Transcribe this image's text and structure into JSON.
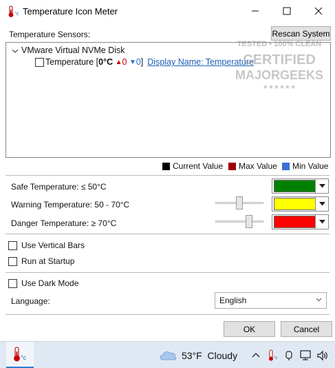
{
  "window": {
    "title": "Temperature Icon Meter",
    "app_icon": "thermometer-celsius-icon",
    "controls": [
      "minimize-icon",
      "maximize-icon",
      "close-icon"
    ]
  },
  "sensors": {
    "label": "Temperature Sensors:",
    "rescan_button": "Rescan System",
    "tree": {
      "device": "VMware Virtual NVMe Disk",
      "sensor": {
        "checked": false,
        "prefix": "Temperature [",
        "current": "0°C",
        "max_arrow": "▲",
        "max": "0",
        "min_arrow": "▼",
        "min": "0",
        "suffix": "]",
        "display_name_link": "Display Name: Temperature"
      }
    }
  },
  "legend": {
    "current": {
      "label": "Current Value",
      "color": "#000000"
    },
    "max": {
      "label": "Max Value",
      "color": "#a00000"
    },
    "min": {
      "label": "Min Value",
      "color": "#3a6fd8"
    }
  },
  "thresholds": {
    "safe": {
      "label": "Safe Temperature: ≤ 50°C",
      "color": "#008000"
    },
    "warning": {
      "label": "Warning Temperature: 50 - 70°C",
      "color": "#ffff00",
      "slider_value": 50
    },
    "danger": {
      "label": "Danger Temperature: ≥ 70°C",
      "color": "#ff0000",
      "slider_value": 70
    }
  },
  "options": {
    "vertical_bars": {
      "label": "Use Vertical Bars",
      "checked": false
    },
    "run_at_startup": {
      "label": "Run at Startup",
      "checked": false
    },
    "dark_mode": {
      "label": "Use Dark Mode",
      "checked": false
    }
  },
  "language": {
    "label": "Language:",
    "selected": "English"
  },
  "buttons": {
    "ok": "OK",
    "cancel": "Cancel"
  },
  "taskbar": {
    "app_icon": "thermometer-celsius-icon",
    "weather_temp": "53°F",
    "weather_desc": "Cloudy",
    "weather_icon": "cloud-icon",
    "tray_icons": [
      "chevron-up-icon",
      "thermometer-celsius-icon",
      "meet-now-icon",
      "network-icon",
      "volume-icon"
    ]
  },
  "watermark": {
    "line1": "TESTED • 100% CLEAN",
    "line2": "CERTIFIED",
    "line3": "MAJORGEEKS",
    "line4": "★★★★★★"
  }
}
